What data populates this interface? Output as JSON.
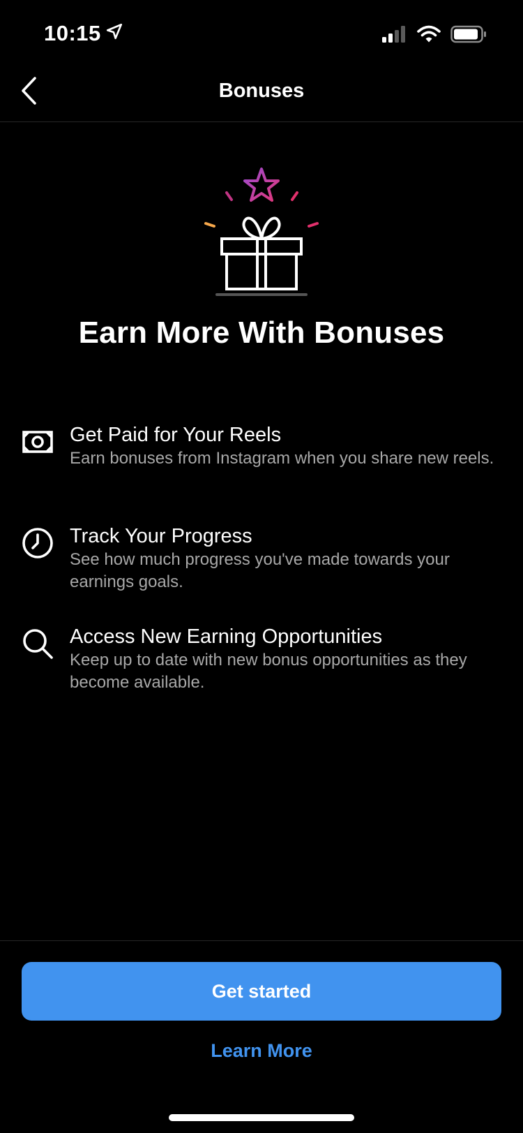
{
  "status_bar": {
    "time": "10:15"
  },
  "header": {
    "title": "Bonuses"
  },
  "hero": {
    "headline": "Earn More With Bonuses"
  },
  "features": [
    {
      "icon": "money-icon",
      "title": "Get Paid for Your Reels",
      "description": "Earn bonuses from Instagram when you share new reels."
    },
    {
      "icon": "clock-icon",
      "title": "Track Your Progress",
      "description": "See how much progress you've made towards your earnings goals."
    },
    {
      "icon": "search-icon",
      "title": "Access New Earning Opportunities",
      "description": "Keep up to date with new bonus opportunities as they become available."
    }
  ],
  "actions": {
    "primary_label": "Get started",
    "secondary_label": "Learn More"
  },
  "colors": {
    "background": "#000000",
    "accent": "#4193ef",
    "secondary_text": "#a8a8a8"
  }
}
